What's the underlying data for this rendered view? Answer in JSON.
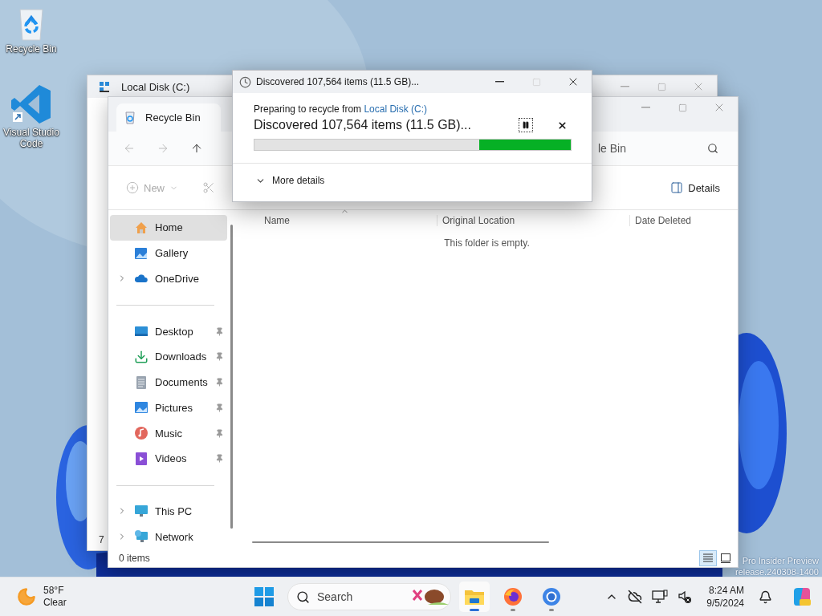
{
  "desktop": {
    "icons": [
      {
        "kind": "recycle",
        "label": "Recycle Bin"
      },
      {
        "kind": "vscode",
        "label": "Visual Studio Code"
      }
    ],
    "watermark": {
      "line_1": "Pro Insider Preview",
      "line_2": "release.240308-1400"
    }
  },
  "back_window": {
    "title": "Local Disk (C:)",
    "status": "7"
  },
  "explorer": {
    "tab_title": "Recycle Bin",
    "address": "le Bin",
    "new_label": "New",
    "details_label": "Details",
    "sidebar": [
      [
        {
          "label": "Home",
          "kind": "home",
          "selected": true,
          "expandable": false,
          "pinned": false
        },
        {
          "label": "Gallery",
          "kind": "gallery",
          "selected": false,
          "expandable": false,
          "pinned": false
        },
        {
          "label": "OneDrive",
          "kind": "cloud",
          "selected": false,
          "expandable": true,
          "pinned": false
        }
      ],
      [
        {
          "label": "Desktop",
          "kind": "desktop",
          "selected": false,
          "expandable": false,
          "pinned": true
        },
        {
          "label": "Downloads",
          "kind": "downloads",
          "selected": false,
          "expandable": false,
          "pinned": true
        },
        {
          "label": "Documents",
          "kind": "documents",
          "selected": false,
          "expandable": false,
          "pinned": true
        },
        {
          "label": "Pictures",
          "kind": "pictures",
          "selected": false,
          "expandable": false,
          "pinned": true
        },
        {
          "label": "Music",
          "kind": "music",
          "selected": false,
          "expandable": false,
          "pinned": true
        },
        {
          "label": "Videos",
          "kind": "videos",
          "selected": false,
          "expandable": false,
          "pinned": true
        }
      ],
      [
        {
          "label": "This PC",
          "kind": "pc",
          "selected": false,
          "expandable": true,
          "pinned": false
        },
        {
          "label": "Network",
          "kind": "network",
          "selected": false,
          "expandable": true,
          "pinned": false
        }
      ]
    ],
    "columns": [
      "Name",
      "Original Location",
      "Date Deleted"
    ],
    "empty_text": "This folder is empty.",
    "status": "0 items",
    "views": [
      {
        "kind": "details",
        "selected": true
      },
      {
        "kind": "tiles",
        "selected": false
      }
    ]
  },
  "dialog": {
    "title": "Discovered 107,564 items (11.5 GB)...",
    "source_prefix": "Preparing to recycle from",
    "source_link": "Local Disk (C:)",
    "status": "Discovered 107,564 items (11.5 GB)...",
    "level": 0.29,
    "more_details": {
      "label": "More details",
      "expanded": false
    }
  },
  "taskbar": {
    "weather": {
      "temp": "58°F",
      "condition": "Clear"
    },
    "search_placeholder": "Search",
    "apps": [
      {
        "kind": "explorer",
        "active": true
      },
      {
        "kind": "firefox",
        "active": false
      },
      {
        "kind": "chrome",
        "active": false
      }
    ],
    "time": "8:24 AM",
    "date": "9/5/2024"
  }
}
